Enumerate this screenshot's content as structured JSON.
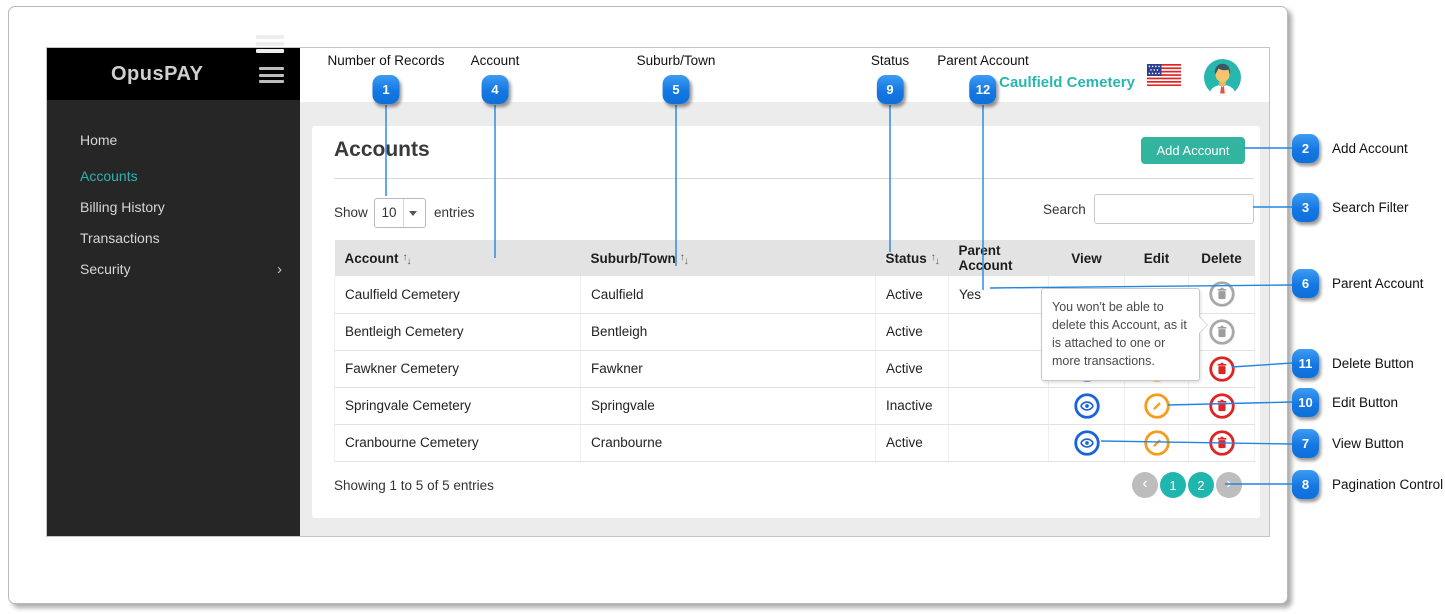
{
  "annotations": {
    "top": [
      {
        "num": "1",
        "label": "Number of Records"
      },
      {
        "num": "4",
        "label": "Account"
      },
      {
        "num": "5",
        "label": "Suburb/Town"
      },
      {
        "num": "9",
        "label": "Status"
      },
      {
        "num": "12",
        "label": "Parent Account"
      }
    ],
    "right": [
      {
        "num": "2",
        "label": "Add Account"
      },
      {
        "num": "3",
        "label": "Search Filter"
      },
      {
        "num": "6",
        "label": "Parent Account"
      },
      {
        "num": "11",
        "label": "Delete Button"
      },
      {
        "num": "10",
        "label": "Edit Button"
      },
      {
        "num": "7",
        "label": "View Button"
      },
      {
        "num": "8",
        "label": "Pagination Control"
      }
    ]
  },
  "sidebar": {
    "logo": "OpusPAY",
    "items": [
      {
        "label": "Home",
        "active": false
      },
      {
        "label": "Accounts",
        "active": true
      },
      {
        "label": "Billing History",
        "active": false
      },
      {
        "label": "Transactions",
        "active": false
      },
      {
        "label": "Security",
        "active": false,
        "has_submenu": true
      }
    ]
  },
  "header": {
    "account_name": "Caulfield Cemetery"
  },
  "page": {
    "title": "Accounts",
    "add_button": "Add Account",
    "show_label": "Show",
    "page_size": "10",
    "entries_label": "entries",
    "search_label": "Search",
    "search_value": "",
    "footer_info": "Showing 1 to 5 of 5 entries",
    "pagination": {
      "pages": [
        "1",
        "2"
      ]
    }
  },
  "table": {
    "headers": [
      "Account",
      "Suburb/Town",
      "Status",
      "Parent Account",
      "View",
      "Edit",
      "Delete"
    ],
    "rows": [
      {
        "account": "Caulfield Cemetery",
        "suburb": "Caulfield",
        "status": "Active",
        "parent": "Yes",
        "view": false,
        "edit": false,
        "delete": "disabled"
      },
      {
        "account": "Bentleigh Cemetery",
        "suburb": "Bentleigh",
        "status": "Active",
        "parent": "",
        "view": false,
        "edit": false,
        "delete": "disabled"
      },
      {
        "account": "Fawkner Cemetery",
        "suburb": "Fawkner",
        "status": "Active",
        "parent": "",
        "view": true,
        "edit": true,
        "delete": "enabled"
      },
      {
        "account": "Springvale Cemetery",
        "suburb": "Springvale",
        "status": "Inactive",
        "parent": "",
        "view": true,
        "edit": true,
        "delete": "enabled"
      },
      {
        "account": "Cranbourne Cemetery",
        "suburb": "Cranbourne",
        "status": "Active",
        "parent": "",
        "view": true,
        "edit": true,
        "delete": "enabled"
      }
    ]
  },
  "tooltip": {
    "text": "You won't be able to delete this Account, as it is attached to one or more transactions."
  },
  "colors": {
    "accent_teal": "#2ab5ae",
    "button_teal": "#32b49f",
    "badge_blue": "#1578e2",
    "line_blue": "#2186e0",
    "view_blue": "#1a63d9",
    "edit_orange": "#f59c1a",
    "delete_red": "#e02424",
    "disabled_gray": "#9e9e9e",
    "pagination_teal": "#1fb6ae"
  }
}
